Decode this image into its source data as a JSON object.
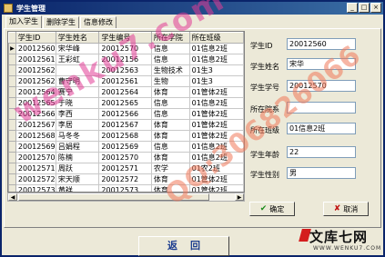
{
  "window": {
    "title": "学生管理",
    "controls": [
      "_",
      "□",
      "×"
    ]
  },
  "tabs": [
    {
      "label": "加入学生"
    },
    {
      "label": "删除学生"
    },
    {
      "label": "信息修改"
    }
  ],
  "grid": {
    "columns": [
      "学生ID",
      "学生姓名",
      "学生编号",
      "所在学院",
      "所在班级"
    ],
    "rows": [
      [
        "20012560",
        "宋华峰",
        "20012570",
        "信息",
        "01信息2班"
      ],
      [
        "20012561",
        "王彩虹",
        "20012156",
        "信息",
        "01信息2班"
      ],
      [
        "20012562",
        "",
        "20012563",
        "生物技术",
        "01生3"
      ],
      [
        "20012562",
        "曹守明",
        "20012561",
        "生物",
        "01生3"
      ],
      [
        "20012564",
        "赛宁",
        "20012564",
        "体育",
        "01管体2班"
      ],
      [
        "20012565",
        "于晓",
        "20012565",
        "信息",
        "01信息2班"
      ],
      [
        "20012566",
        "李西",
        "20012566",
        "信息",
        "01管体2班"
      ],
      [
        "20012567",
        "李居",
        "20012567",
        "体育",
        "01管体2班"
      ],
      [
        "20012568",
        "马冬冬",
        "20012568",
        "体育",
        "01管体2班"
      ],
      [
        "20012569",
        "吕娟程",
        "20012569",
        "信息",
        "01信息2班"
      ],
      [
        "20012570",
        "陈楠",
        "20012570",
        "体育",
        "01信息2班"
      ],
      [
        "20012571",
        "周跃",
        "20012571",
        "农学",
        "01农2班"
      ],
      [
        "20012572",
        "宋天顺",
        "20012572",
        "体育",
        "01管体2班"
      ],
      [
        "20012573",
        "黄祥",
        "20012573",
        "体育",
        "01管体2班"
      ],
      [
        "20012574",
        "",
        "20012574",
        "农学",
        "01农2班"
      ]
    ]
  },
  "form": {
    "id_label": "学生ID",
    "id_value": "20012560",
    "name_label": "学生姓名",
    "name_value": "宋华",
    "no_label": "学生学号",
    "no_value": "20012570",
    "college_label": "所在院系",
    "college_value": "",
    "class_label": "所在班级",
    "class_value": "01信息2班",
    "age_label": "学生年龄",
    "age_value": "22",
    "gender_label": "学生性别",
    "gender_value": "男"
  },
  "buttons": {
    "ok": "确定",
    "cancel": "取消",
    "back": "返回"
  },
  "watermarks": {
    "text1": "wenku7.com",
    "text2": "QQ:306826066",
    "logo_main": "文库七网",
    "logo_sub": "WWW.WENKU7.COM"
  },
  "colors": {
    "titlebar": "#0a246a",
    "back_text": "#1b3c8f",
    "ok_check": "#1a8a1a",
    "cancel_x": "#c01010"
  }
}
